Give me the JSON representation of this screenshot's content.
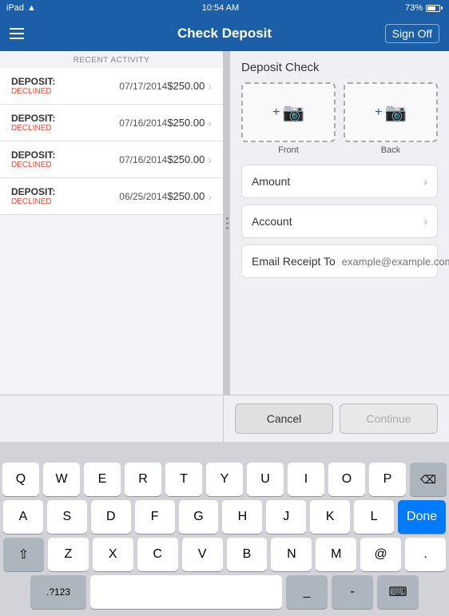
{
  "statusBar": {
    "device": "iPad",
    "wifi": "wifi",
    "time": "10:54 AM",
    "battery_pct": "73%",
    "battery_icon": "🔋"
  },
  "navBar": {
    "menu_icon": "menu",
    "title": "Check Deposit",
    "sign_off": "Sign Off"
  },
  "leftPanel": {
    "section_header": "RECENT ACTIVITY",
    "items": [
      {
        "type": "DEPOSIT:",
        "status": "DECLINED",
        "date": "07/17/2014",
        "amount": "$250.00"
      },
      {
        "type": "DEPOSIT:",
        "status": "DECLINED",
        "date": "07/16/2014",
        "amount": "$250.00"
      },
      {
        "type": "DEPOSIT:",
        "status": "DECLINED",
        "date": "07/16/2014",
        "amount": "$250.00"
      },
      {
        "type": "DEPOSIT:",
        "status": "DECLINED",
        "date": "06/25/2014",
        "amount": "$250.00"
      }
    ]
  },
  "rightPanel": {
    "title": "Deposit Check",
    "front_label": "Front",
    "back_label": "Back",
    "amount_label": "Amount",
    "account_label": "Account",
    "email_label": "Email Receipt To",
    "email_placeholder": "example@example.com"
  },
  "actionButtons": {
    "cancel": "Cancel",
    "continue": "Continue"
  },
  "keyboard": {
    "rows": [
      [
        "Q",
        "W",
        "E",
        "R",
        "T",
        "Y",
        "U",
        "I",
        "O",
        "P"
      ],
      [
        "A",
        "S",
        "D",
        "F",
        "G",
        "H",
        "J",
        "K",
        "L"
      ],
      [
        "⇧",
        "Z",
        "X",
        "C",
        "V",
        "B",
        "N",
        "M",
        "⌫"
      ],
      [
        ".?123",
        " ",
        "_",
        "-",
        "⌨"
      ]
    ],
    "done": "Done"
  }
}
